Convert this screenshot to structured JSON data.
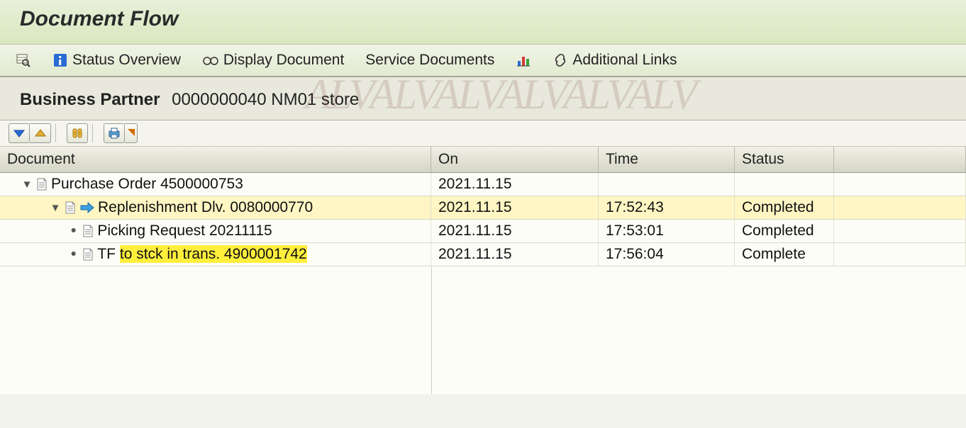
{
  "title": "Document Flow",
  "toolbar": {
    "status_overview": "Status Overview",
    "display_document": "Display Document",
    "service_documents": "Service Documents",
    "additional_links": "Additional Links"
  },
  "business_partner": {
    "label": "Business Partner",
    "value": "0000000040 NM01 store"
  },
  "columns": {
    "document": "Document",
    "on": "On",
    "time": "Time",
    "status": "Status"
  },
  "rows": [
    {
      "indent": 1,
      "toggle": true,
      "arrow": false,
      "doc": "Purchase Order 4500000753",
      "on": "2021.11.15",
      "time": "",
      "status": "",
      "highlight": false,
      "yellow_part": ""
    },
    {
      "indent": 2,
      "toggle": true,
      "arrow": true,
      "doc_prefix": "",
      "doc": "Replenishment Dlv. 0080000770",
      "on": "2021.11.15",
      "time": "17:52:43",
      "status": "Completed",
      "highlight": true,
      "yellow_part": ""
    },
    {
      "indent": 3,
      "toggle": false,
      "arrow": false,
      "doc": "Picking Request 20211115",
      "on": "2021.11.15",
      "time": "17:53:01",
      "status": "Completed",
      "highlight": false,
      "yellow_part": ""
    },
    {
      "indent": 3,
      "toggle": false,
      "arrow": false,
      "doc_prefix": "TF ",
      "doc": "to stck in trans. 4900001742",
      "on": "2021.11.15",
      "time": "17:56:04",
      "status": "Complete",
      "highlight": false,
      "yellow_part": "to stck in trans. 4900001742"
    }
  ]
}
